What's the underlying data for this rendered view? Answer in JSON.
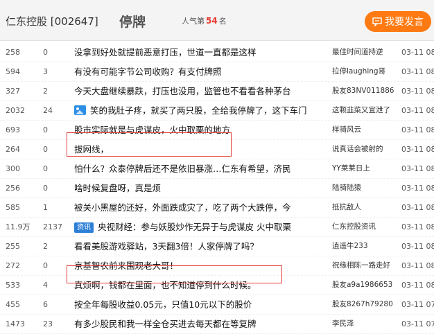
{
  "header": {
    "stock_name": "仁东控股 [002647]",
    "status": "停牌",
    "popularity_label": "人气第",
    "popularity_rank": "54",
    "popularity_suffix": "名",
    "post_button": "我要发言",
    "accent_color": "#ff7a12"
  },
  "rows": [
    {
      "read": "258",
      "reply": "0",
      "title": "没拿到好处就提前恶意打压，世道一直都是这样",
      "author": "最佳时间道持逆",
      "time": "03-11 08"
    },
    {
      "read": "594",
      "reply": "3",
      "title": "有没有可能字节公司收购？有支付牌照",
      "author": "拉停laughing哥",
      "time": "03-11 08"
    },
    {
      "read": "327",
      "reply": "2",
      "title": "今天大盘继续暴跌，打压也没用，监管也不看看各种茅台",
      "author": "股友83NV011886",
      "time": "03-11 08"
    },
    {
      "read": "2032",
      "reply": "24",
      "title": "笑的我肚子疼，就买了两只股，全给我停牌了，这下车门",
      "author": "这颗韭菜又宣泄了",
      "time": "03-11 08",
      "icon": "image-icon"
    },
    {
      "read": "693",
      "reply": "0",
      "title": "股市实际就是与虎谋皮，火中取栗的地方",
      "author": "样骑风云",
      "time": "03-11 08"
    },
    {
      "read": "264",
      "reply": "0",
      "title": "拔网线，",
      "author": "说真话会被射的",
      "time": "03-11 08"
    },
    {
      "read": "300",
      "reply": "0",
      "title": "怕什么？众泰停牌后还不是依旧暴涨…仁东有希望，济民",
      "author": "YY莱莱日上",
      "time": "03-11 08"
    },
    {
      "read": "256",
      "reply": "0",
      "title": "啥时候复盘呀，真是烦",
      "author": "陆骑陆猿",
      "time": "03-11 08"
    },
    {
      "read": "585",
      "reply": "1",
      "title": "被关小黑屋的还好，外面跌成灾了，吃了两个大跌停，今",
      "author": "抵抗敌人",
      "time": "03-11 08"
    },
    {
      "read": "11.9万",
      "reply": "2137",
      "title": "央视财经：参与妖股炒作无异于与虎谋皮 火中取栗",
      "author": "仁东控股资讯",
      "time": "03-11 08",
      "tag": "资讯"
    },
    {
      "read": "255",
      "reply": "2",
      "title": "看看美股游戏驿站，3天翻3倍！人家停牌了吗？",
      "author": "逍遥牛233",
      "time": "03-11 08"
    },
    {
      "read": "272",
      "reply": "0",
      "title": "京基智农前来围观老大哥！",
      "author": "祝缘相陈一路走好",
      "time": "03-11 08"
    },
    {
      "read": "533",
      "reply": "4",
      "title": "真烦啊，钱都在里面，也不知道停到什么时候。",
      "author": "股友a9a1986653",
      "time": "03-11 08"
    },
    {
      "read": "455",
      "reply": "6",
      "title": "按全年每股收益0.05元，只值10元以下的股价",
      "author": "股友8267h79280",
      "time": "03-11 07"
    },
    {
      "read": "1473",
      "reply": "23",
      "title": "有多少股民和我一样全仓买进去每天都在等复牌",
      "author": "李民泽",
      "time": "03-11 07"
    }
  ]
}
